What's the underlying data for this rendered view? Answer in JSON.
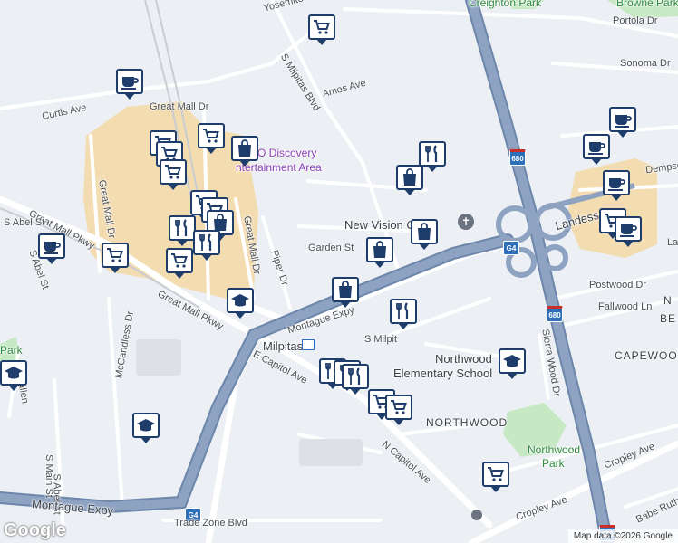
{
  "map": {
    "colors": {
      "background": "#eceff3",
      "commercial": "#f3dcb0",
      "highway": "#8ea3c2",
      "highway_edge": "#6d86ab",
      "road": "#ffffff",
      "park": "#c6e8c3",
      "pin_border": "#1e3d6b"
    },
    "street_labels": [
      {
        "text": "Yosemite Dr"
      },
      {
        "text": "Creighton Park"
      },
      {
        "text": "Browne Park"
      },
      {
        "text": "Portola Dr"
      },
      {
        "text": "Sonoma Dr"
      },
      {
        "text": "S Milpitas Blvd"
      },
      {
        "text": "Ames Ave"
      },
      {
        "text": "Curtis Ave"
      },
      {
        "text": "Great Mall Dr"
      },
      {
        "text": "Great Mall Dr"
      },
      {
        "text": "Great Mall Dr"
      },
      {
        "text": "Dempsey Rd"
      },
      {
        "text": "Landess"
      },
      {
        "text": "Great Mall Pkwy"
      },
      {
        "text": "S Abel St"
      },
      {
        "text": "S Abel St"
      },
      {
        "text": "Piper Dr"
      },
      {
        "text": "Garden St"
      },
      {
        "text": "New Vision Ch"
      },
      {
        "text": "Montague Expy"
      },
      {
        "text": "S Milpit"
      },
      {
        "text": "Postwood Dr"
      },
      {
        "text": "Fallwood Ln"
      },
      {
        "text": "Great Mall Pkwy"
      },
      {
        "text": "McCandless Dr"
      },
      {
        "text": "Milpitas"
      },
      {
        "text": "E Capitol Ave"
      },
      {
        "text": "Northwood"
      },
      {
        "text": "Elementary School"
      },
      {
        "text": "Sierra Wood Dr"
      },
      {
        "text": "CAPEWOOD"
      },
      {
        "text": "NORTHWOOD"
      },
      {
        "text": "Northwood"
      },
      {
        "text": "Park"
      },
      {
        "text": "N Capitol Ave"
      },
      {
        "text": "Cropley Ave"
      },
      {
        "text": "Cropley Ave"
      },
      {
        "text": "Babe Ruth"
      },
      {
        "text": "S Main St"
      },
      {
        "text": "S Abel St"
      },
      {
        "text": "Montague Expy"
      },
      {
        "text": "Trade Zone Blvd"
      },
      {
        "text": "Park"
      },
      {
        "text": "Fallen"
      },
      {
        "text": "BE"
      },
      {
        "text": "N"
      },
      {
        "text": "La"
      }
    ],
    "poi_label": {
      "line1": "O Discovery",
      "line2": "ntertainment Area"
    },
    "highway_shields": [
      {
        "text": "680"
      },
      {
        "text": "G4"
      },
      {
        "text": "680"
      },
      {
        "text": "G4"
      },
      {
        "text": "680"
      }
    ],
    "markers": [
      {
        "icon": "shopping-cart-icon"
      },
      {
        "icon": "coffee-cup-icon"
      },
      {
        "icon": "shopping-cart-icon"
      },
      {
        "icon": "shopping-cart-icon"
      },
      {
        "icon": "shopping-cart-icon"
      },
      {
        "icon": "shopping-bag-icon"
      },
      {
        "icon": "shopping-cart-icon"
      },
      {
        "icon": "shopping-cart-icon"
      },
      {
        "icon": "shopping-cart-icon"
      },
      {
        "icon": "shopping-bag-icon"
      },
      {
        "icon": "fork-knife-icon"
      },
      {
        "icon": "fork-knife-icon"
      },
      {
        "icon": "shopping-cart-icon"
      },
      {
        "icon": "shopping-cart-icon"
      },
      {
        "icon": "coffee-cup-icon"
      },
      {
        "icon": "graduation-cap-icon"
      },
      {
        "icon": "fork-knife-icon"
      },
      {
        "icon": "shopping-bag-icon"
      },
      {
        "icon": "shopping-bag-icon"
      },
      {
        "icon": "shopping-bag-icon"
      },
      {
        "icon": "shopping-bag-icon"
      },
      {
        "icon": "fork-knife-icon"
      },
      {
        "icon": "fork-knife-icon"
      },
      {
        "icon": "fork-knife-icon"
      },
      {
        "icon": "fork-knife-icon"
      },
      {
        "icon": "shopping-cart-icon"
      },
      {
        "icon": "shopping-cart-icon"
      },
      {
        "icon": "graduation-cap-icon"
      },
      {
        "icon": "shopping-cart-icon"
      },
      {
        "icon": "graduation-cap-icon"
      },
      {
        "icon": "graduation-cap-icon"
      },
      {
        "icon": "coffee-cup-icon"
      },
      {
        "icon": "coffee-cup-icon"
      },
      {
        "icon": "coffee-cup-icon"
      },
      {
        "icon": "shopping-cart-icon"
      },
      {
        "icon": "coffee-cup-icon"
      }
    ],
    "google_logo": "Google",
    "attribution": "Map data ©2026 Google",
    "transit_label": "Milpitas"
  }
}
